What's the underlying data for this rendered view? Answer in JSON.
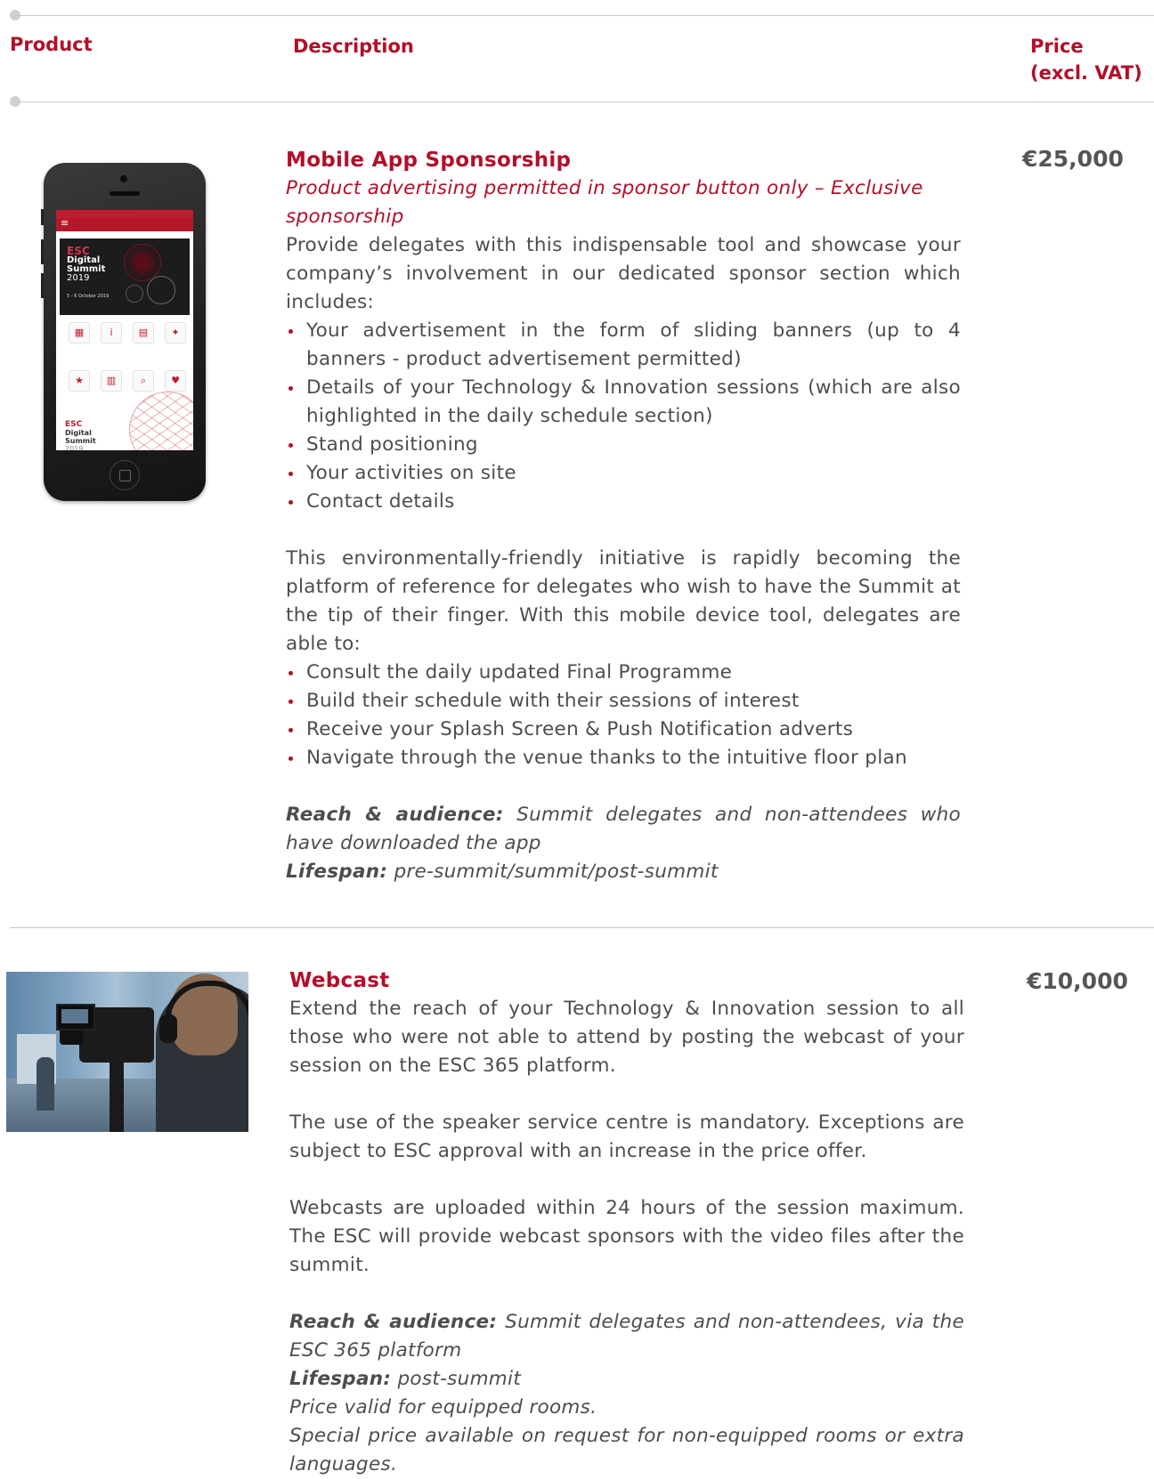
{
  "header": {
    "product": "Product",
    "description": "Description",
    "price_line1": "Price",
    "price_line2": "(excl. VAT)"
  },
  "items": [
    {
      "title": "Mobile App Sponsorship",
      "subtitle_line1": "Product advertising permitted in sponsor button only –  Exclusive",
      "subtitle_line2": "sponsorship",
      "intro": "Provide delegates with this indispensable tool and showcase your company’s involvement in our dedicated sponsor section which includes:",
      "bullets": [
        "Your advertisement in the form of sliding banners (up to 4 banners - product advertisement permitted)",
        "Details of your Technology & Innovation sessions (which are also highlighted in the daily schedule section)",
        "Stand positioning",
        "Your activities on site",
        "Contact details"
      ],
      "para2": "This environmentally-friendly initiative is rapidly becoming the platform of reference for delegates who wish to have the Summit at the tip of their finger. With this mobile device tool, delegates are able to:",
      "bullets2": [
        "Consult the daily updated Final Programme",
        "Build their schedule with their sessions of interest",
        "Receive your Splash Screen & Push Notification adverts",
        "Navigate through the venue thanks to the intuitive floor plan"
      ],
      "reach_label": "Reach & audience:",
      "reach_text": " Summit delegates and non-attendees who have downloaded the app",
      "lifespan_label": "Lifespan:",
      "lifespan_text": " pre-summit/summit/post-summit",
      "price": "€25,000",
      "image": {
        "name": "phone-app-image",
        "brand_line1": "ESC",
        "brand_line2": "Digital",
        "brand_line3": "Summit",
        "brand_year": "2019",
        "date_text": "5 - 6 October 2019"
      }
    },
    {
      "title": "Webcast",
      "para1": "Extend the reach of your Technology & Innovation session to all those who were not able to attend by posting the webcast of your session on the ESC 365 platform.",
      "para2": "The use of the speaker service centre is mandatory. Exceptions are subject to ESC approval with an increase in the price offer.",
      "para3": "Webcasts are uploaded within 24 hours of the session maximum. The ESC will provide webcast sponsors with the video files after the summit.",
      "reach_label": "Reach & audience:",
      "reach_text": " Summit delegates and non-attendees, via the ESC 365 platform",
      "lifespan_label": "Lifespan:",
      "lifespan_text": " post-summit",
      "note1": "Price valid for equipped rooms.",
      "note2": "Special price available on request for non-equipped rooms or extra languages.",
      "price": "€10,000"
    }
  ],
  "colors": {
    "accent": "#b0102a",
    "body_text": "#4d4d4d",
    "rule": "#c8c8c8"
  }
}
